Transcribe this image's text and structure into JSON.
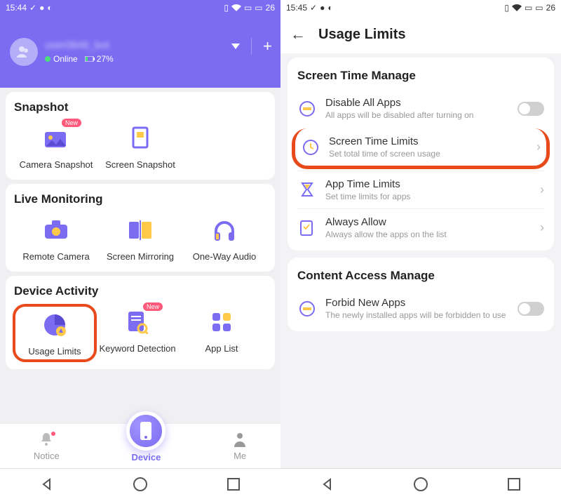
{
  "left": {
    "status": {
      "time": "15:44",
      "battery": "26"
    },
    "header": {
      "username": "user0846_bot",
      "status": "Online",
      "battery": "27%"
    },
    "snapshot": {
      "title": "Snapshot",
      "tiles": [
        {
          "label": "Camera Snapshot",
          "new": true
        },
        {
          "label": "Screen Snapshot",
          "new": false
        }
      ]
    },
    "live": {
      "title": "Live Monitoring",
      "tiles": [
        {
          "label": "Remote Camera"
        },
        {
          "label": "Screen Mirroring"
        },
        {
          "label": "One-Way Audio"
        }
      ]
    },
    "activity": {
      "title": "Device Activity",
      "tiles": [
        {
          "label": "Usage Limits",
          "highlight": true
        },
        {
          "label": "Keyword Detection",
          "new": true
        },
        {
          "label": "App List"
        }
      ]
    },
    "nav": {
      "notice": "Notice",
      "device": "Device",
      "me": "Me"
    }
  },
  "right": {
    "status": {
      "time": "15:45",
      "battery": "26"
    },
    "title": "Usage Limits",
    "screenTime": {
      "title": "Screen Time Manage",
      "rows": [
        {
          "title": "Disable All Apps",
          "sub": "All apps will be disabled after turning on",
          "toggle": true
        },
        {
          "title": "Screen Time Limits",
          "sub": "Set total time of screen usage",
          "highlight": true
        },
        {
          "title": "App Time Limits",
          "sub": "Set time limits for apps"
        },
        {
          "title": "Always Allow",
          "sub": "Always allow the apps on the list"
        }
      ]
    },
    "content": {
      "title": "Content Access Manage",
      "rows": [
        {
          "title": "Forbid New Apps",
          "sub": "The newly installed apps will be forbidden to use",
          "toggle": true
        }
      ]
    }
  }
}
